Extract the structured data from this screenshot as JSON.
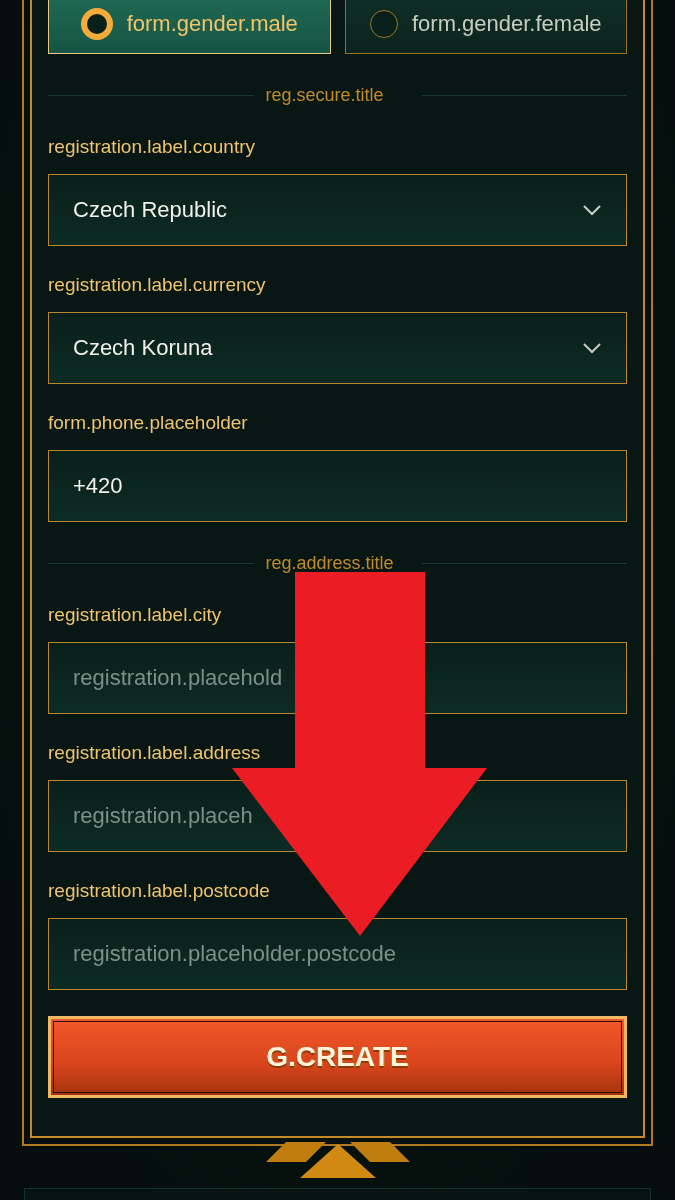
{
  "gender": [
    {
      "label": "form.gender.male",
      "selected": true
    },
    {
      "label": "form.gender.female",
      "selected": false
    }
  ],
  "sections": [
    {
      "title": "reg.secure.title",
      "fields": [
        {
          "kind": "select",
          "label": "registration.label.country",
          "value": "Czech Republic"
        },
        {
          "kind": "select",
          "label": "registration.label.currency",
          "value": "Czech Koruna"
        },
        {
          "kind": "input",
          "label": "form.phone.placeholder",
          "value": "+420"
        }
      ]
    },
    {
      "title": "reg.address.title",
      "fields": [
        {
          "kind": "input",
          "label": "registration.label.city",
          "placeholder": "registration.placehold"
        },
        {
          "kind": "input",
          "label": "registration.label.address",
          "placeholder": "registration.placeh"
        },
        {
          "kind": "input",
          "label": "registration.label.postcode",
          "placeholder": "registration.placeholder.postcode"
        }
      ]
    }
  ],
  "submit": {
    "label": "G.CREATE"
  },
  "annotation": {
    "kind": "arrow"
  }
}
